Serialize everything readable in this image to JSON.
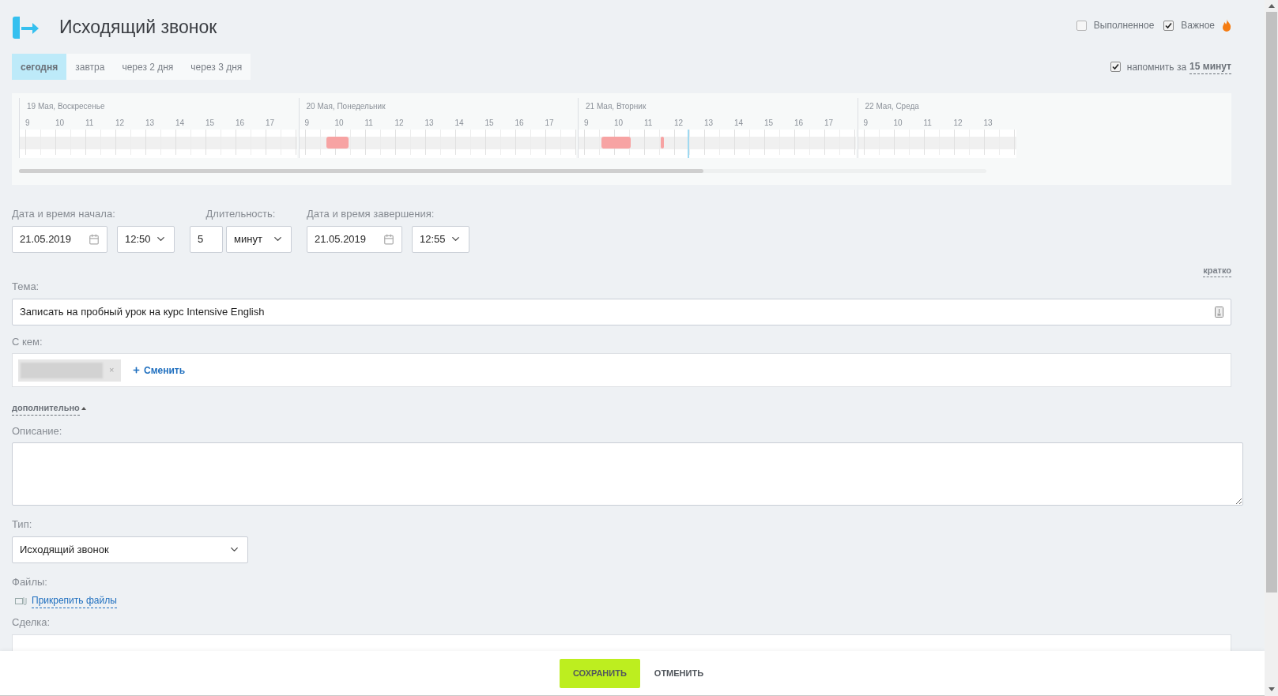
{
  "header": {
    "title": "Исходящий звонок"
  },
  "flags": [
    {
      "label": "Выполненное",
      "checked": false,
      "kind": "plain"
    },
    {
      "label": "Важное",
      "checked": true,
      "kind": "important"
    }
  ],
  "day_tabs": [
    {
      "label": "сегодня",
      "selected": true
    },
    {
      "label": "завтра",
      "selected": false
    },
    {
      "label": "через 2 дня",
      "selected": false
    },
    {
      "label": "через 3 дня",
      "selected": false
    }
  ],
  "reminder": {
    "checked": true,
    "label": "напомнить за",
    "value": "15 минут"
  },
  "timeline": {
    "days": [
      {
        "label": "19 Мая, Воскресенье",
        "hours": [
          "9",
          "10",
          "11",
          "12",
          "13",
          "14",
          "15",
          "16",
          "17"
        ],
        "busy": false,
        "today": false
      },
      {
        "label": "20 Мая, Понедельник",
        "hours": [
          "9",
          "10",
          "11",
          "12",
          "13",
          "14",
          "15",
          "16",
          "17"
        ],
        "busy": true,
        "today": false
      },
      {
        "label": "21 Мая, Вторник",
        "hours": [
          "9",
          "10",
          "11",
          "12",
          "13",
          "14",
          "15",
          "16",
          "17"
        ],
        "busy": true,
        "today": true
      },
      {
        "label": "22 Мая, Среда",
        "hours": [
          "9",
          "10",
          "11",
          "12",
          "13"
        ],
        "busy": false,
        "today": false
      }
    ]
  },
  "schedule": {
    "start": {
      "label": "Дата и время начала:",
      "date": "21.05.2019",
      "time": "12:50"
    },
    "duration": {
      "label": "Длительность:",
      "value": "5",
      "unit": "минут"
    },
    "end": {
      "label": "Дата и время завершения:",
      "date": "21.05.2019",
      "time": "12:55"
    }
  },
  "brief_link": "кратко",
  "subject": {
    "label": "Тема:",
    "value": "Записать на пробный урок на курс Intensive English"
  },
  "contact": {
    "label": "С кем:",
    "remove": "×",
    "change": "Сменить"
  },
  "more_toggle": {
    "label": "дополнительно",
    "expanded": true
  },
  "description": {
    "label": "Описание:"
  },
  "type": {
    "label": "Тип:",
    "value": "Исходящий звонок"
  },
  "files": {
    "label": "Файлы:",
    "link": "Прикрепить файлы"
  },
  "deal": {
    "label": "Сделка:"
  },
  "footer": {
    "save": "СОХРАНИТЬ",
    "cancel": "ОТМЕНИТЬ"
  }
}
